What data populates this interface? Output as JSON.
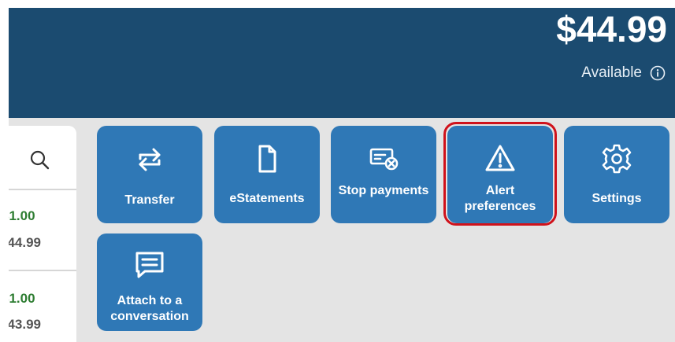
{
  "account": {
    "balance": "$44.99",
    "available_label": "Available"
  },
  "transactions": [
    {
      "amount": "$1.00",
      "balance": "$44.99"
    },
    {
      "amount": "$1.00",
      "balance": "$43.99"
    }
  ],
  "actions": [
    {
      "label": "Transfer",
      "icon": "transfer-arrows-icon"
    },
    {
      "label": "eStatements",
      "icon": "document-icon"
    },
    {
      "label": "Stop payments",
      "icon": "stop-check-icon"
    },
    {
      "label": "Alert preferences",
      "icon": "warning-triangle-icon",
      "highlighted": true
    },
    {
      "label": "Settings",
      "icon": "gear-icon"
    },
    {
      "label": "Attach to a conversation",
      "icon": "chat-message-icon"
    }
  ],
  "colors": {
    "header": "#1b4b70",
    "tile": "#2f78b6",
    "highlight": "#d0121b",
    "positive_amount": "#2e7d32"
  }
}
